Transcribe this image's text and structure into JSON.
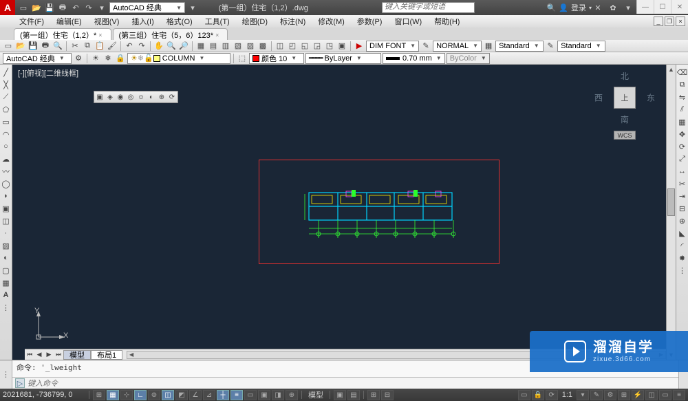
{
  "titlebar": {
    "logo": "A",
    "workspace": "AutoCAD 经典",
    "filename": "(第一组）住宅（1,2）.dwg",
    "search_placeholder": "键入关键字或短语",
    "login_label": "登录",
    "qat_icons": [
      "new",
      "open",
      "save",
      "print",
      "undo",
      "redo"
    ],
    "right_icons": [
      "✕",
      "✿",
      "⬇",
      "?",
      "▾"
    ]
  },
  "menubar": {
    "items": [
      "文件(F)",
      "编辑(E)",
      "视图(V)",
      "插入(I)",
      "格式(O)",
      "工具(T)",
      "绘图(D)",
      "标注(N)",
      "修改(M)",
      "参数(P)",
      "窗口(W)",
      "帮助(H)"
    ]
  },
  "doctabs": {
    "tabs": [
      {
        "label": "(第一组）住宅（1,2）*",
        "active": true
      },
      {
        "label": "(第三组）住宅（5，6）123*",
        "active": false
      }
    ]
  },
  "toolbar2": {
    "dimstyle": "DIM  FONT",
    "mlstyle": "NORMAL",
    "tablestyle": "Standard",
    "textstyle": "Standard"
  },
  "toolbar3": {
    "workspace": "AutoCAD 经典",
    "layer": "COLUMN",
    "color_label": "颜色 10",
    "linetype": "ByLayer",
    "lineweight": "0.70 mm",
    "plotstyle": "ByColor"
  },
  "canvas": {
    "view_label": "[-][俯视][二维线框]",
    "cube": {
      "n": "北",
      "s": "南",
      "e": "东",
      "w": "西",
      "top": "上",
      "wcs": "WCS"
    },
    "ucs": {
      "x": "X",
      "y": "Y"
    }
  },
  "layouttabs": {
    "model": "模型",
    "layout1": "布局1"
  },
  "cmdline": {
    "history": "命令: '_lweight",
    "prompt_placeholder": "键入命令"
  },
  "statusbar": {
    "coords": "2021681, -736799, 0",
    "model_label": "模型",
    "scale": "1:1"
  },
  "watermark": {
    "big": "溜溜自学",
    "small": "zixue.3d66.com"
  }
}
